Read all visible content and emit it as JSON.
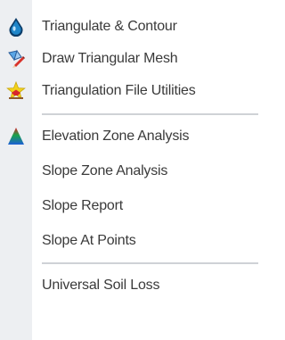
{
  "menu": {
    "items": [
      {
        "label": "Triangulate & Contour",
        "icon": "triangulate-contour-icon"
      },
      {
        "label": "Draw Triangular Mesh",
        "icon": "draw-triangular-mesh-icon"
      },
      {
        "label": "Triangulation File Utilities",
        "icon": "triangulation-file-utilities-icon"
      },
      {
        "label": "Elevation Zone Analysis",
        "icon": "elevation-zone-analysis-icon"
      },
      {
        "label": "Slope Zone Analysis",
        "icon": ""
      },
      {
        "label": "Slope Report",
        "icon": ""
      },
      {
        "label": "Slope At Points",
        "icon": ""
      },
      {
        "label": "Universal Soil Loss",
        "icon": ""
      }
    ]
  },
  "colors": {
    "gutter": "#edeff2",
    "separator": "#cfd2d6",
    "text": "#3a3a3a",
    "drop_blue": "#1f86c9",
    "drop_dark": "#0b3c68",
    "star_yellow": "#f2d21c",
    "star_red": "#d8262b",
    "pencil_red": "#d9332b",
    "gradient_red": "#d8232a",
    "gradient_green": "#18a34a",
    "gradient_blue": "#1c5fd6"
  }
}
